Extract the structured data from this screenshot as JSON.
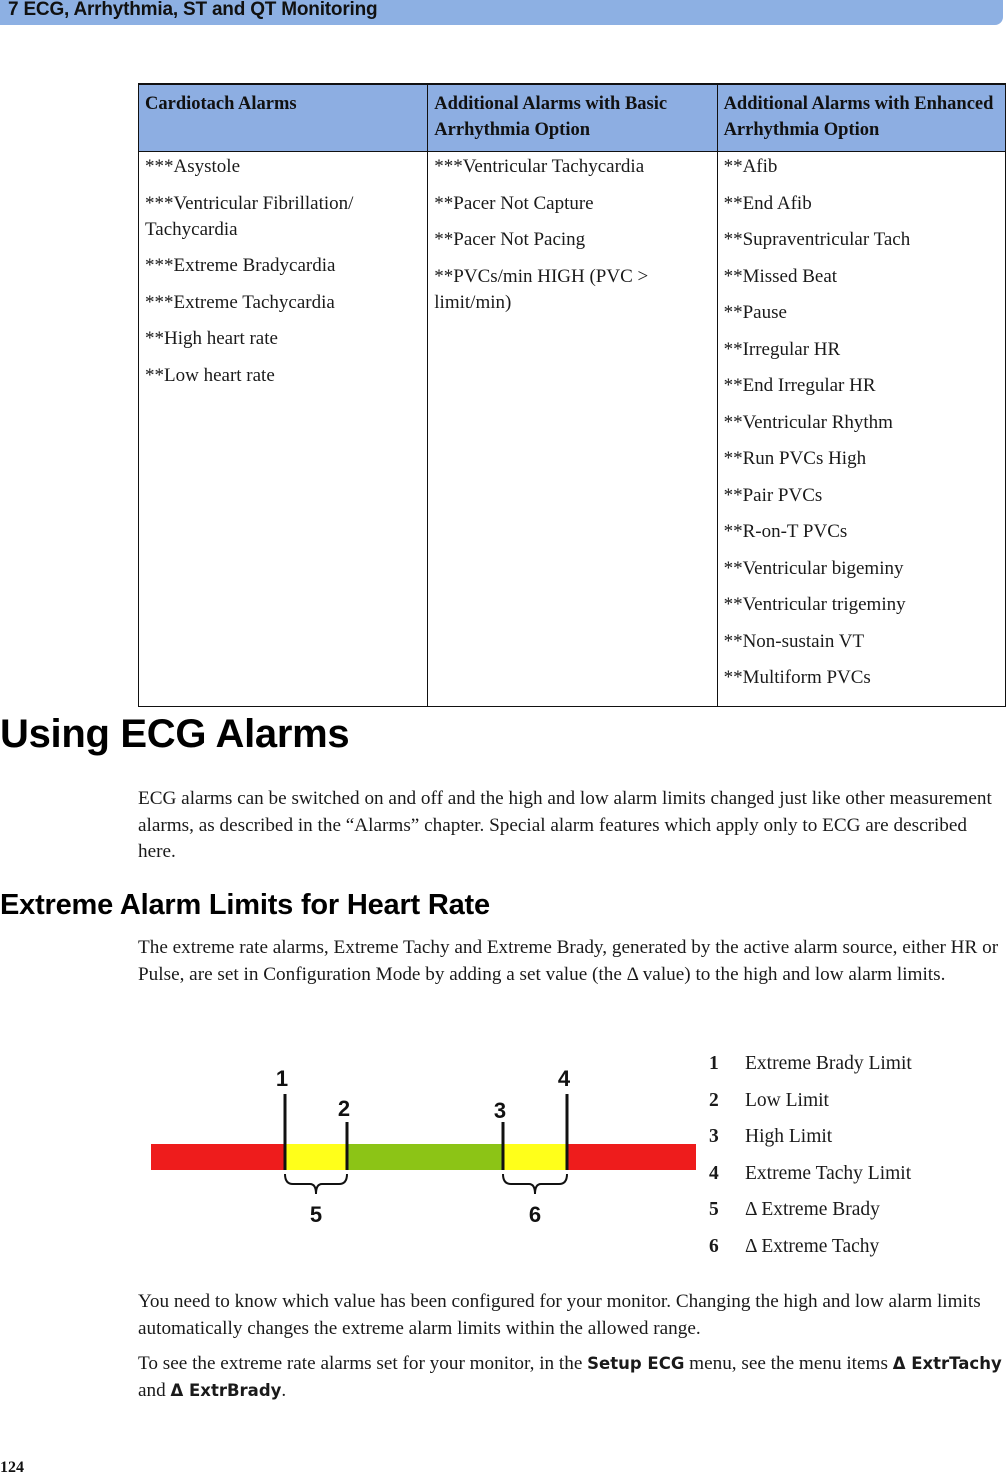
{
  "header": {
    "chapter_title": "7  ECG, Arrhythmia, ST and QT Monitoring"
  },
  "alarm_table": {
    "columns": [
      {
        "header": "Cardiotach Alarms",
        "items": [
          "***Asystole",
          "***Ventricular Fibrillation/ Tachycardia",
          "***Extreme Bradycardia",
          "***Extreme Tachycardia",
          "**High heart rate",
          "**Low heart rate"
        ]
      },
      {
        "header": "Additional Alarms with Basic Arrhythmia Option",
        "items": [
          "***Ventricular Tachycardia",
          "**Pacer Not Capture",
          "**Pacer Not Pacing",
          "**PVCs/min HIGH (PVC > limit/min)"
        ]
      },
      {
        "header": "Additional Alarms with Enhanced Arrhythmia Option",
        "items": [
          "**Afib",
          "**End Afib",
          "**Supraventricular Tach",
          "**Missed Beat",
          "**Pause",
          "**Irregular HR",
          "**End Irregular HR",
          "**Ventricular Rhythm",
          "**Run PVCs High",
          "**Pair PVCs",
          "**R-on-T PVCs",
          "**Ventricular bigeminy",
          "**Ventricular trigeminy",
          "**Non-sustain VT",
          "**Multiform PVCs"
        ]
      }
    ]
  },
  "section": {
    "title": "Using ECG Alarms",
    "paragraph": "ECG alarms can be switched on and off and the high and low alarm limits changed just like other measurement alarms, as described in the “Alarms” chapter. Special alarm features which apply only to ECG are described here."
  },
  "subsection": {
    "title": "Extreme Alarm Limits for Heart Rate",
    "paragraph": "The extreme rate alarms, Extreme Tachy and Extreme Brady, generated by the active alarm source, either HR or Pulse, are set in Configuration Mode by adding a set value (the Δ value) to the high and low alarm limits."
  },
  "diagram": {
    "zones": [
      {
        "name": "extreme-low-zone",
        "color": "#ee1c1c"
      },
      {
        "name": "delta-brady-zone",
        "color": "#ffff1a"
      },
      {
        "name": "normal-zone",
        "color": "#8cc416"
      },
      {
        "name": "delta-tachy-zone",
        "color": "#ffff1a"
      },
      {
        "name": "extreme-high-zone",
        "color": "#ee1c1c"
      }
    ],
    "markers": [
      "1",
      "2",
      "3",
      "4"
    ],
    "brace_labels": [
      "5",
      "6"
    ]
  },
  "legend": [
    {
      "num": "1",
      "label": "Extreme Brady Limit"
    },
    {
      "num": "2",
      "label": "Low Limit"
    },
    {
      "num": "3",
      "label": "High Limit"
    },
    {
      "num": "4",
      "label": "Extreme Tachy Limit"
    },
    {
      "num": "5",
      "label": "Δ Extreme Brady"
    },
    {
      "num": "6",
      "label": "Δ Extreme Tachy"
    }
  ],
  "closing": {
    "paragraph1": "You need to know which value has been configured for your monitor. Changing the high and low alarm limits automatically changes the extreme alarm limits within the allowed range.",
    "p2_before": "To see the extreme rate alarms set for your monitor, in the ",
    "p2_menu": "Setup ECG",
    "p2_middle": " menu, see the menu items ",
    "p2_item1": "Δ ExtrTachy",
    "p2_and": " and ",
    "p2_item2": "Δ ExtrBrady",
    "p2_end": "."
  },
  "footer": {
    "page_number": "124"
  }
}
